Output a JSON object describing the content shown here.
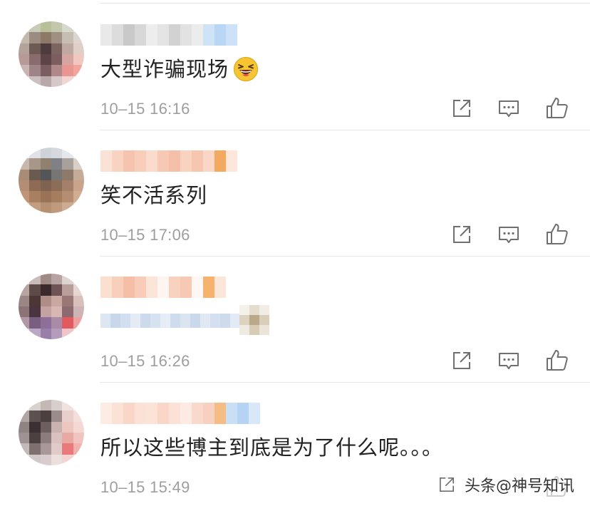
{
  "comments": [
    {
      "text": "大型诈骗现场",
      "emoji": "grinning-squint-emoji",
      "time": "10–15 16:16"
    },
    {
      "text": "笑不活系列",
      "time": "10–15 17:06"
    },
    {
      "text": "",
      "time": "10–15 16:26"
    },
    {
      "text": "所以这些博主到底是为了什么呢。。。",
      "time": "10–15 15:49"
    }
  ],
  "actions": {
    "share_icon": "share-icon",
    "reply_icon": "reply-icon",
    "like_icon": "thumbs-up-icon"
  },
  "watermark": {
    "text": "头条@神号知讯"
  }
}
